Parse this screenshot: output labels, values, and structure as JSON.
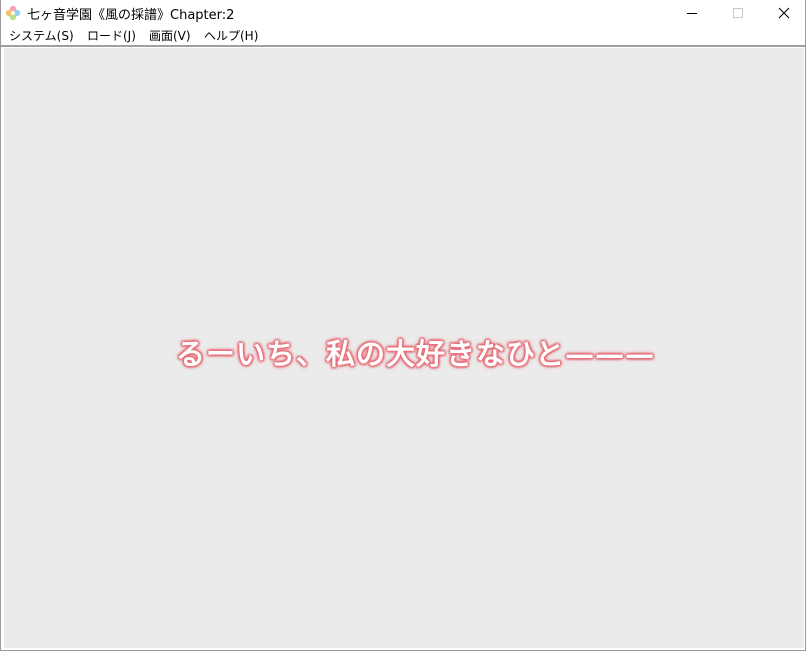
{
  "window": {
    "title": "七ヶ音学園《風の採譜》Chapter:2",
    "app_icon": "flower-app-icon",
    "controls": {
      "minimize": "minimize-icon",
      "maximize": "maximize-icon",
      "close": "close-icon"
    }
  },
  "menubar": {
    "items": [
      {
        "label": "システム(S)"
      },
      {
        "label": "ロード(J)"
      },
      {
        "label": "画面(V)"
      },
      {
        "label": "ヘルプ(H)"
      }
    ]
  },
  "scene": {
    "text": "るーいち、私の大好きなひと———",
    "text_color": "#ffffff",
    "glow_color": "#e8707a",
    "background_color": "#ebebeb"
  }
}
